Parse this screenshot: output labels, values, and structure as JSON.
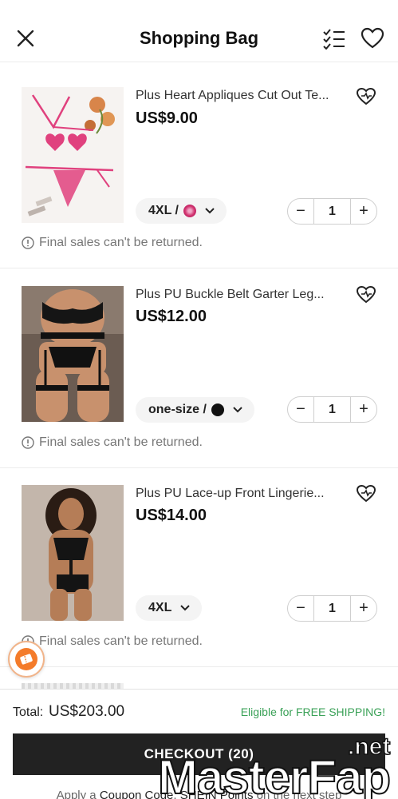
{
  "header": {
    "title": "Shopping Bag"
  },
  "items": [
    {
      "title": "Plus Heart Appliques Cut Out Te...",
      "price": "US$9.00",
      "variant": "4XL /",
      "swatch": "pink-pattern",
      "qty": "1",
      "notice": "Final sales can't be returned."
    },
    {
      "title": "Plus PU Buckle Belt Garter Leg...",
      "price": "US$12.00",
      "variant": "one-size /",
      "swatch": "black",
      "qty": "1",
      "notice": "Final sales can't be returned."
    },
    {
      "title": "Plus PU Lace-up Front Lingerie...",
      "price": "US$14.00",
      "variant": "4XL",
      "swatch": "",
      "qty": "1",
      "notice": "Final sales can't be returned."
    }
  ],
  "footer": {
    "total_label": "Total:",
    "total_value": "US$203.00",
    "shipping_note": "Eligible for FREE SHIPPING!",
    "checkout_label": "CHECKOUT (20)",
    "hint_prefix": "Apply a",
    "hint_coupon": "Coupon Code",
    "hint_sep": ",",
    "hint_points": "SHEIN Points",
    "hint_suffix": "on the next step"
  },
  "watermark": {
    "net": ".net",
    "brand": "MasterFap"
  },
  "colors": {
    "accent_green": "#3aa157",
    "checkout_bg": "#222222",
    "pink": "#e0417e"
  }
}
